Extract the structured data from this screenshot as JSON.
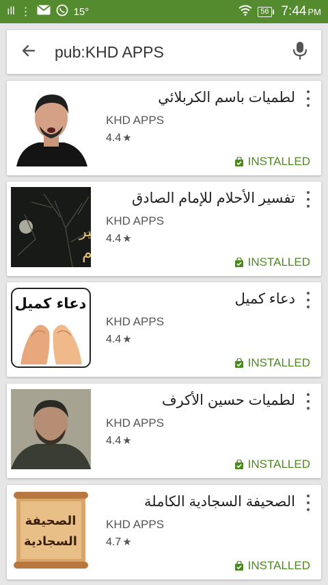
{
  "status_bar": {
    "signal": "ıll",
    "temperature": "15°",
    "battery": "56",
    "time": "7:44",
    "ampm": "PM"
  },
  "search": {
    "query": "pub:KHD APPS"
  },
  "apps": [
    {
      "title": "لطميات باسم الكربلائي",
      "developer": "KHD APPS",
      "rating": "4.4",
      "status": "INSTALLED"
    },
    {
      "title": "تفسير الأحلام للإمام الصادق",
      "developer": "KHD APPS",
      "rating": "4.4",
      "status": "INSTALLED"
    },
    {
      "title": "دعاء كميل",
      "developer": "KHD APPS",
      "rating": "4.4",
      "status": "INSTALLED"
    },
    {
      "title": "لطميات حسين الأكرف",
      "developer": "KHD APPS",
      "rating": "4.4",
      "status": "INSTALLED"
    },
    {
      "title": "الصحيفة السجادية الكاملة",
      "developer": "KHD APPS",
      "rating": "4.7",
      "status": "INSTALLED"
    }
  ],
  "thumb_text": {
    "dream_line1": "تفسير",
    "dream_line2": "الأحلام",
    "dua": "دعاء كميل",
    "sahifa_line1": "الصحيفة",
    "sahifa_line2": "السجادية"
  },
  "icons": {
    "back": "arrow-left-icon",
    "mic": "microphone-icon",
    "more": "more-vertical-icon",
    "installed": "shopping-bag-check-icon"
  },
  "colors": {
    "status_bar": "#558b2f",
    "installed": "#4b8a1c",
    "background": "#e6e6e6"
  }
}
